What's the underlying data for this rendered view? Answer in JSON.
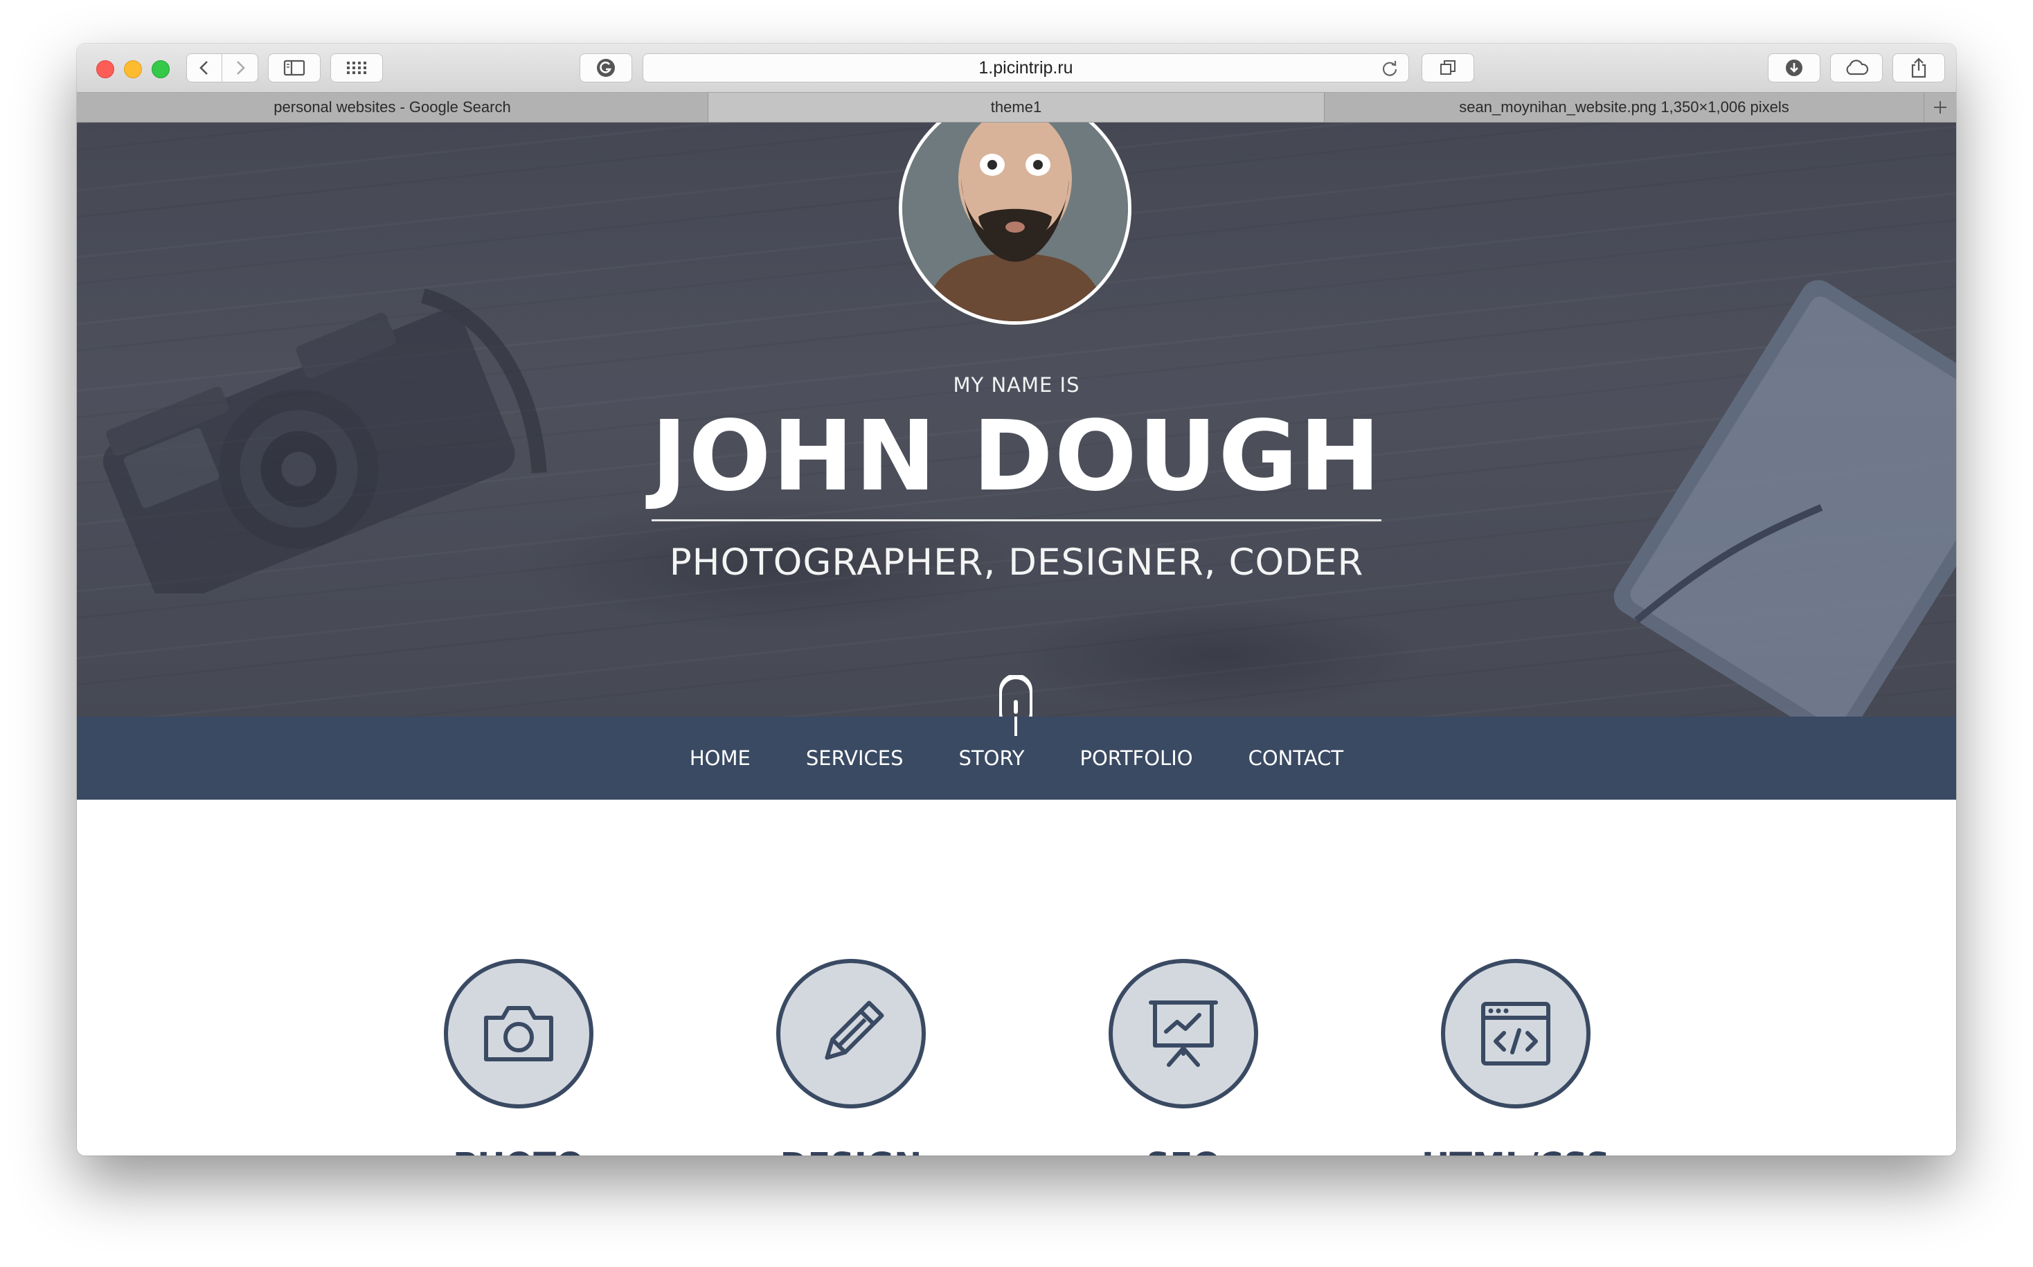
{
  "browser": {
    "url": "1.picintrip.ru",
    "tabs": [
      {
        "label": "personal websites - Google Search",
        "active": false
      },
      {
        "label": "theme1",
        "active": true
      },
      {
        "label": "sean_moynihan_website.png 1,350×1,006 pixels",
        "active": false
      }
    ]
  },
  "hero": {
    "intro": "MY NAME IS",
    "name": "JOHN DOUGH",
    "subtitle": "PHOTOGRAPHER, DESIGNER, CODER"
  },
  "nav": {
    "items": [
      "HOME",
      "SERVICES",
      "STORY",
      "PORTFOLIO",
      "CONTACT"
    ]
  },
  "services": [
    {
      "label": "PHOTO",
      "icon": "camera-icon"
    },
    {
      "label": "DESIGN",
      "icon": "pencil-icon"
    },
    {
      "label": "SEO",
      "icon": "presentation-chart-icon"
    },
    {
      "label": "HTML/CSS",
      "icon": "code-window-icon"
    }
  ],
  "colors": {
    "nav_background": "#3a4a63",
    "service_text": "#33415a",
    "service_circle_fill": "#d3d8df"
  }
}
